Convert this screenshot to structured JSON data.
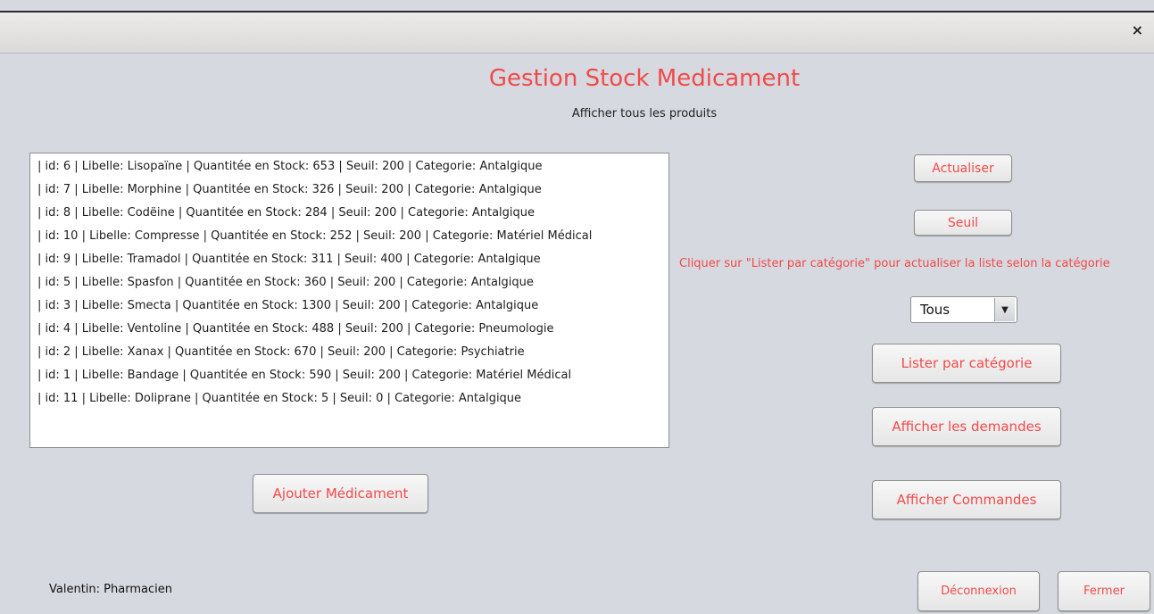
{
  "window": {
    "close_glyph": "×"
  },
  "header": {
    "title": "Gestion Stock Medicament",
    "subtitle": "Afficher tous les produits"
  },
  "products": [
    "| id: 6 | Libelle: Lisopaïne | Quantitée en Stock: 653 | Seuil: 200 | Categorie: Antalgique",
    "| id: 7 | Libelle: Morphine | Quantitée en Stock: 326 | Seuil: 200 | Categorie: Antalgique",
    "| id: 8 | Libelle: Codëine | Quantitée en Stock: 284 | Seuil: 200 | Categorie: Antalgique",
    "| id: 10 | Libelle: Compresse | Quantitée en Stock: 252 | Seuil: 200 | Categorie: Matériel Médical",
    "| id: 9 | Libelle: Tramadol | Quantitée en Stock: 311 | Seuil: 400 | Categorie: Antalgique",
    "| id: 5 | Libelle: Spasfon | Quantitée en Stock: 360 | Seuil: 200 | Categorie: Antalgique",
    "| id: 3 | Libelle: Smecta | Quantitée en Stock: 1300 | Seuil: 200 | Categorie: Antalgique",
    "| id: 4 | Libelle: Ventoline | Quantitée en Stock: 488 | Seuil: 200 | Categorie: Pneumologie",
    "| id: 2 | Libelle: Xanax | Quantitée en Stock: 670 | Seuil: 200 | Categorie: Psychiatrie",
    "| id: 1 | Libelle: Bandage | Quantitée en Stock: 590 | Seuil: 200 | Categorie: Matériel Médical",
    "| id: 11 | Libelle: Doliprane | Quantitée en Stock: 5 | Seuil: 0 | Categorie: Antalgique"
  ],
  "buttons": {
    "actualiser": "Actualiser",
    "seuil": "Seuil",
    "lister": "Lister par catégorie",
    "demandes": "Afficher les demandes",
    "commandes": "Afficher Commandes",
    "ajouter": "Ajouter Médicament",
    "deconnexion": "Déconnexion",
    "fermer": "Fermer"
  },
  "hint": "Cliquer sur  \"Lister par catégorie\" pour actualiser la liste selon la catégorie",
  "category_select": {
    "value": "Tous",
    "arrow_icon": "chevron-down-icon"
  },
  "user": "Valentin: Pharmacien",
  "colors": {
    "accent": "#f24a4a",
    "background": "#d6d9df"
  }
}
